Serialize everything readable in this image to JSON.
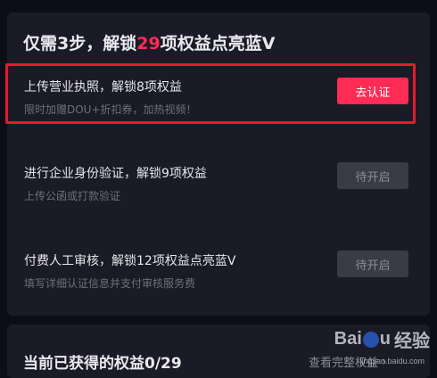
{
  "header": {
    "prefix": "仅需3步，解锁",
    "count": "29",
    "suffix": "项权益点亮蓝V"
  },
  "steps": [
    {
      "title": "上传营业执照，解锁8项权益",
      "subtitle": "限时加赠DOU+折扣券，加热视频！",
      "button": "去认证",
      "state": "active"
    },
    {
      "title": "进行企业身份验证，解锁9项权益",
      "subtitle": "上传公函或打款验证",
      "button": "待开启",
      "state": "locked"
    },
    {
      "title": "付费人工审核，解锁12项权益点亮蓝V",
      "subtitle": "填写详细认证信息并支付审核服务费",
      "button": "待开启",
      "state": "locked"
    }
  ],
  "footer": {
    "progress_label": "当前已获得的权益0/29",
    "link_label": "查看完整权益",
    "link_icon": "chevron-right-icon"
  },
  "watermark": {
    "brand": "Bai",
    "brand_tail": "u",
    "brand_cn": "经验",
    "url": "jingyan.baidu.com"
  },
  "colors": {
    "accent": "#fe2c55",
    "highlight_border": "#e8192e",
    "card": "#1a1b27",
    "background": "#0c0d16"
  }
}
